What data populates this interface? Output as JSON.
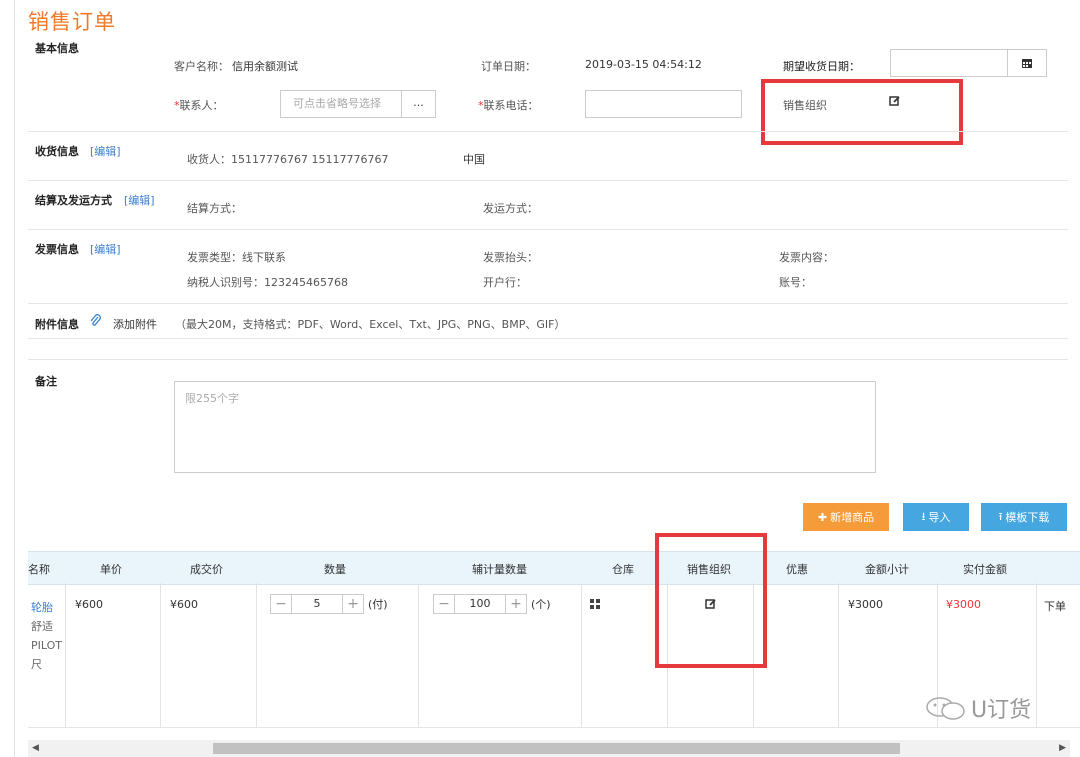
{
  "page_title": "销售订单",
  "basic": {
    "section": "基本信息",
    "customer_label": "客户名称：",
    "customer_value": "信用余额测试",
    "order_date_label": "订单日期：",
    "order_date_value": "2019-03-15 04:54:12",
    "expected_date_label": "期望收货日期：",
    "contact_label": "联系人：",
    "contact_placeholder": "可点击省略号选择",
    "contact_more": "...",
    "phone_label": "联系电话：",
    "sales_org_label": "销售组织",
    "req_mark": "*"
  },
  "shipping": {
    "section": "收货信息",
    "edit": "[编辑]",
    "receiver": "收货人：15117776767 15117776767",
    "country": "中国"
  },
  "settlement": {
    "section": "结算及发运方式",
    "edit": "[编辑]",
    "settle_label": "结算方式：",
    "ship_label": "发运方式："
  },
  "invoice": {
    "section": "发票信息",
    "edit": "[编辑]",
    "type": "发票类型：线下联系",
    "header": "发票抬头：",
    "content": "发票内容：",
    "taxid": "纳税人识别号：123245465768",
    "bank": "开户行：",
    "account": "账号："
  },
  "attachment": {
    "section": "附件信息",
    "add": "添加附件",
    "hint": "（最大20M，支持格式：PDF、Word、Excel、Txt、JPG、PNG、BMP、GIF）"
  },
  "remark": {
    "section": "备注",
    "placeholder": "限255个字"
  },
  "actions": {
    "add_product": "新增商品",
    "import": "导入",
    "template": "模板下载"
  },
  "table": {
    "headers": [
      "名称",
      "单价",
      "成交价",
      "数量",
      "辅计量数量",
      "仓库",
      "销售组织",
      "优惠",
      "金额小计",
      "实付金额"
    ],
    "row": {
      "name_lines": [
        "轮胎",
        "舒适",
        "PILOT",
        "尺"
      ],
      "unit_price": "¥600",
      "deal_price": "¥600",
      "qty": "5",
      "qty_unit": "(付)",
      "aux_qty": "100",
      "aux_unit": "(个)",
      "subtotal": "¥3000",
      "paid": "¥3000",
      "extra": "下单"
    }
  },
  "watermark": "U订货",
  "colors": {
    "accent": "#f07a2b",
    "primary_btn": "#f59b3a",
    "blue_btn": "#46a6e0",
    "highlight": "#e5393b"
  }
}
